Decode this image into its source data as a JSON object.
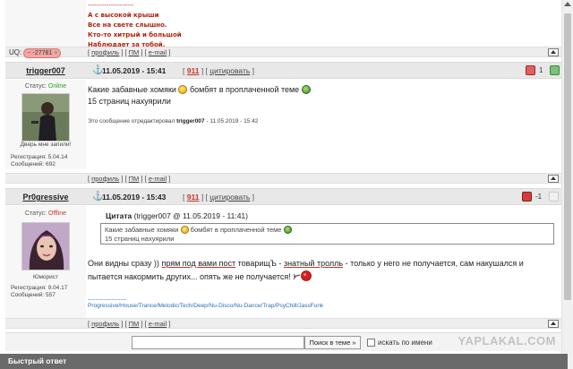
{
  "top_post": {
    "signature_dashes": "----------------------",
    "signature_lines": [
      "А с высокой крыши",
      "Все на свете слышно.",
      "Кто-то хитрый и большой",
      "Наблюдает за тобой."
    ],
    "uq_label": "UQ:",
    "uq_value": "-27781"
  },
  "post_links": {
    "profile": "профиль",
    "pm": "ПМ",
    "email": "e-mail"
  },
  "post1": {
    "nick": "trigger007",
    "date": "11.05.2019 - 15:41",
    "rating": "911",
    "quote_action": "цитировать",
    "status_label": "Статус:",
    "status_value": "Online",
    "caption": "Дверь мне запили!",
    "reg_label": "Регистрация:",
    "reg_value": "5.04.14",
    "msgs_label": "Сообщений:",
    "msgs_value": "692",
    "body_line1_pre": "Какие забавные хомяки",
    "body_line1_post": "бомбят в проплаченной теме",
    "body_line2": "15 страниц нахуярили",
    "edited_pre": "Это сообщение отредактировал",
    "edited_nick": "trigger007",
    "edited_post": "- 11.05.2019 - 15:42",
    "vote_count": "1"
  },
  "post2": {
    "nick": "Pr0gressive",
    "date": "11.05.2019 - 15:43",
    "rating": "911",
    "quote_action": "цитировать",
    "status_label": "Статус:",
    "status_value": "Offline",
    "caption": "Юморист",
    "reg_label": "Регистрация:",
    "reg_value": "9.04.17",
    "msgs_label": "Сообщений:",
    "msgs_value": "557",
    "quote_title": "Цитата",
    "quote_meta": "(trigger007 @ 11.05.2019 - 11:41)",
    "quote_line1_pre": "Какие забавные хомяки",
    "quote_line1_post": "бомбят в проплаченной теме",
    "quote_line2": "15 страниц нахуярили",
    "body_a": "Они видны сразу ))",
    "body_b": "прям под вами пост",
    "body_c": "товарищЪ -",
    "body_d": "знатный тролль",
    "body_e": "- только у него не получается, сам накушался и",
    "body_line2": "пытается накормить других... опять же не получается!",
    "signature_dashes": "--------------------",
    "signature": "Progressive/House/Trance/Melodic/Tech/Deep/Nu-Disco/Nu-Dance/Trap/PsyChill/JassFunk",
    "vote_count": "-1"
  },
  "reply_bar": {
    "search_button": "Поиск в теме »",
    "checkbox_label": "искать по имени"
  },
  "fast_reply": "Быстрый ответ",
  "watermark": "YAPLAKAL.COM",
  "colors": {
    "accent_red": "#c0392b",
    "online_green": "#2d9c2d",
    "link_blue": "#2a6fb0"
  }
}
